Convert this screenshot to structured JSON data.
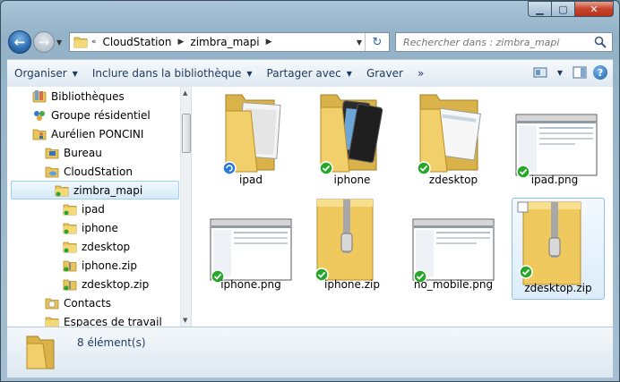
{
  "address": {
    "crumbs": [
      "CloudStation",
      "zimbra_mapi"
    ],
    "overflow": "«"
  },
  "search": {
    "placeholder": "Rechercher dans : zimbra_mapi"
  },
  "toolbar": {
    "organiser": "Organiser",
    "inclure": "Inclure dans la bibliothèque",
    "partager": "Partager avec",
    "graver": "Graver",
    "more": "»"
  },
  "nav": {
    "items": [
      {
        "label": "Bibliothèques",
        "icon": "libraries-icon"
      },
      {
        "label": "Groupe résidentiel",
        "icon": "homegroup-icon"
      },
      {
        "label": "Aurélien PONCINI",
        "icon": "user-folder-icon"
      },
      {
        "label": "Bureau",
        "icon": "folder-icon"
      },
      {
        "label": "CloudStation",
        "icon": "cloudstation-icon"
      },
      {
        "label": "zimbra_mapi",
        "icon": "folder-icon"
      },
      {
        "label": "ipad",
        "icon": "folder-icon"
      },
      {
        "label": "iphone",
        "icon": "folder-icon"
      },
      {
        "label": "zdesktop",
        "icon": "folder-icon"
      },
      {
        "label": "iphone.zip",
        "icon": "zip-folder-icon"
      },
      {
        "label": "zdesktop.zip",
        "icon": "zip-folder-icon"
      },
      {
        "label": "Contacts",
        "icon": "contacts-icon"
      },
      {
        "label": "Espaces de travail",
        "icon": "folder-icon"
      }
    ]
  },
  "files": [
    {
      "name": "ipad",
      "kind": "folder",
      "status": "syncing-icon"
    },
    {
      "name": "iphone",
      "kind": "folder",
      "status": "synced-check-icon"
    },
    {
      "name": "zdesktop",
      "kind": "folder",
      "status": "synced-check-icon"
    },
    {
      "name": "ipad.png",
      "kind": "image",
      "status": "synced-check-icon"
    },
    {
      "name": "iphone.png",
      "kind": "image",
      "status": "synced-check-icon"
    },
    {
      "name": "iphone.zip",
      "kind": "zip",
      "status": "synced-check-icon"
    },
    {
      "name": "no_mobile.png",
      "kind": "image",
      "status": "synced-check-icon"
    },
    {
      "name": "zdesktop.zip",
      "kind": "zip",
      "status": "synced-check-icon",
      "selected": true
    }
  ],
  "status": {
    "count": "8 élément(s)"
  },
  "colors": {
    "accent": "#1e395b",
    "selection": "#d5eaf9",
    "sync_ok": "#26a72a",
    "sync_busy": "#2a7ad6"
  }
}
